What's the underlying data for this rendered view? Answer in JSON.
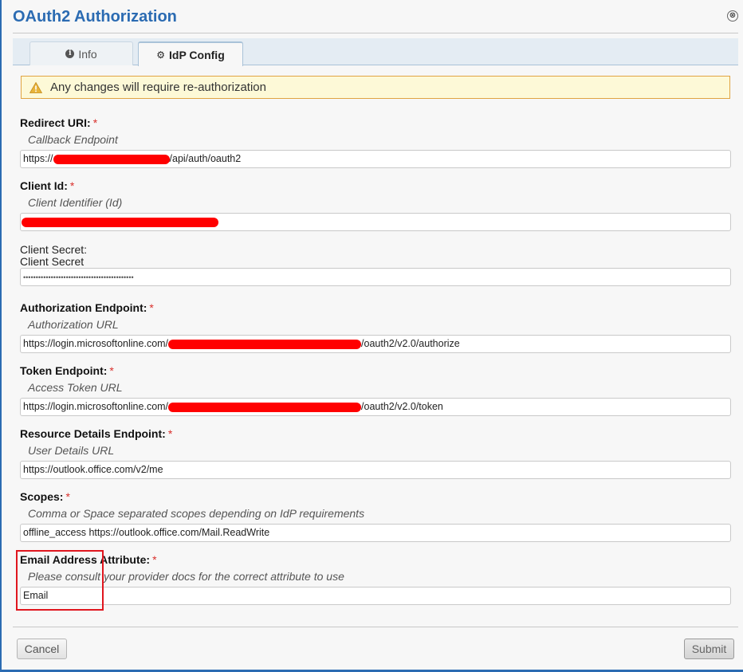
{
  "dialog": {
    "title": "OAuth2 Authorization",
    "close_glyph": "⊗"
  },
  "tabs": [
    {
      "label": "Info",
      "icon": "info-circle-icon",
      "active": false
    },
    {
      "label": "IdP Config",
      "icon": "gear-icon",
      "active": true
    }
  ],
  "warning": {
    "text": "Any changes will require re-authorization",
    "icon": "warning-triangle-icon"
  },
  "fields": {
    "redirect_uri": {
      "label": "Redirect URI:",
      "required": "*",
      "help": "Callback Endpoint",
      "value_prefix": "https://",
      "value_suffix": "/api/auth/oauth2"
    },
    "client_id": {
      "label": "Client Id:",
      "required": "*",
      "help": "Client Identifier (Id)"
    },
    "client_secret": {
      "label": "Client Secret:",
      "help": "Client Secret",
      "value": "••••••••••••••••••••••••••••••••••••••••••••"
    },
    "authorization_endpoint": {
      "label": "Authorization Endpoint:",
      "required": "*",
      "help": "Authorization URL",
      "value_prefix": "https://login.microsoftonline.com/",
      "value_suffix": "/oauth2/v2.0/authorize"
    },
    "token_endpoint": {
      "label": "Token Endpoint:",
      "required": "*",
      "help": "Access Token URL",
      "value_prefix": "https://login.microsoftonline.com/",
      "value_suffix": "/oauth2/v2.0/token"
    },
    "resource_details_endpoint": {
      "label": "Resource Details Endpoint:",
      "required": "*",
      "help": "User Details URL",
      "value": "https://outlook.office.com/v2/me"
    },
    "scopes": {
      "label": "Scopes:",
      "required": "*",
      "help": "Comma or Space separated scopes depending on IdP requirements",
      "value": "offline_access https://outlook.office.com/Mail.ReadWrite"
    },
    "email_attribute": {
      "label": "Email Address Attribute:",
      "required": "*",
      "help": "Please consult your provider docs for the correct attribute to use",
      "value": "Email"
    }
  },
  "buttons": {
    "cancel": "Cancel",
    "submit": "Submit"
  },
  "colors": {
    "title": "#2b6bb2",
    "required": "#d9302c",
    "redaction": "#ff0000",
    "highlight": "#e0161e",
    "warning_bg": "#fdf9d7",
    "warning_border": "#e0a442"
  }
}
